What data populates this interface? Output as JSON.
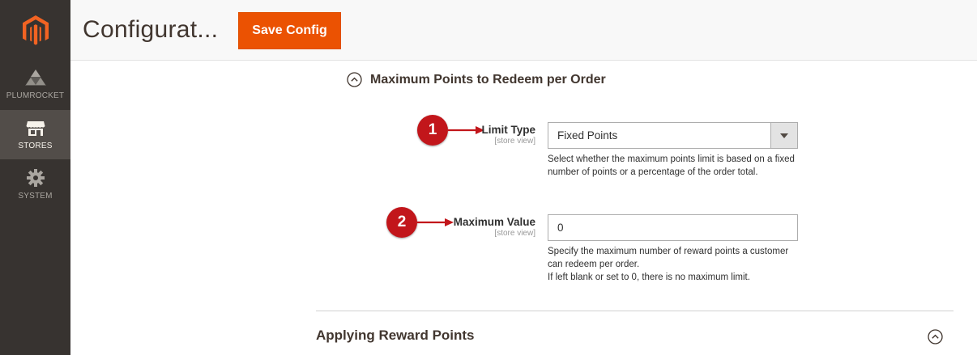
{
  "sidebar": {
    "logo_icon": "magento-logo-icon",
    "items": [
      {
        "label": "PLUMROCKET",
        "icon": "plumrocket-icon"
      },
      {
        "label": "STORES",
        "icon": "store-icon"
      },
      {
        "label": "SYSTEM",
        "icon": "gear-icon"
      }
    ]
  },
  "header": {
    "title": "Configurat...",
    "save_label": "Save Config"
  },
  "section": {
    "title": "Maximum Points to Redeem per Order"
  },
  "fields": {
    "limit_type": {
      "callout": "1",
      "label": "Limit Type",
      "scope": "[store view]",
      "value": "Fixed Points",
      "note": "Select whether the maximum points limit is based on a fixed number of points or a percentage of the order total."
    },
    "max_value": {
      "callout": "2",
      "label": "Maximum Value",
      "scope": "[store view]",
      "value": "0",
      "note_1": "Specify the maximum number of reward points a customer can redeem per order.",
      "note_2": "If left blank or set to 0, there is no maximum limit."
    }
  },
  "section2": {
    "title": "Applying Reward Points"
  },
  "colors": {
    "sidebar_bg": "#373330",
    "sidebar_active": "#524d49",
    "accent": "#eb5202",
    "callout": "#c2161b"
  }
}
